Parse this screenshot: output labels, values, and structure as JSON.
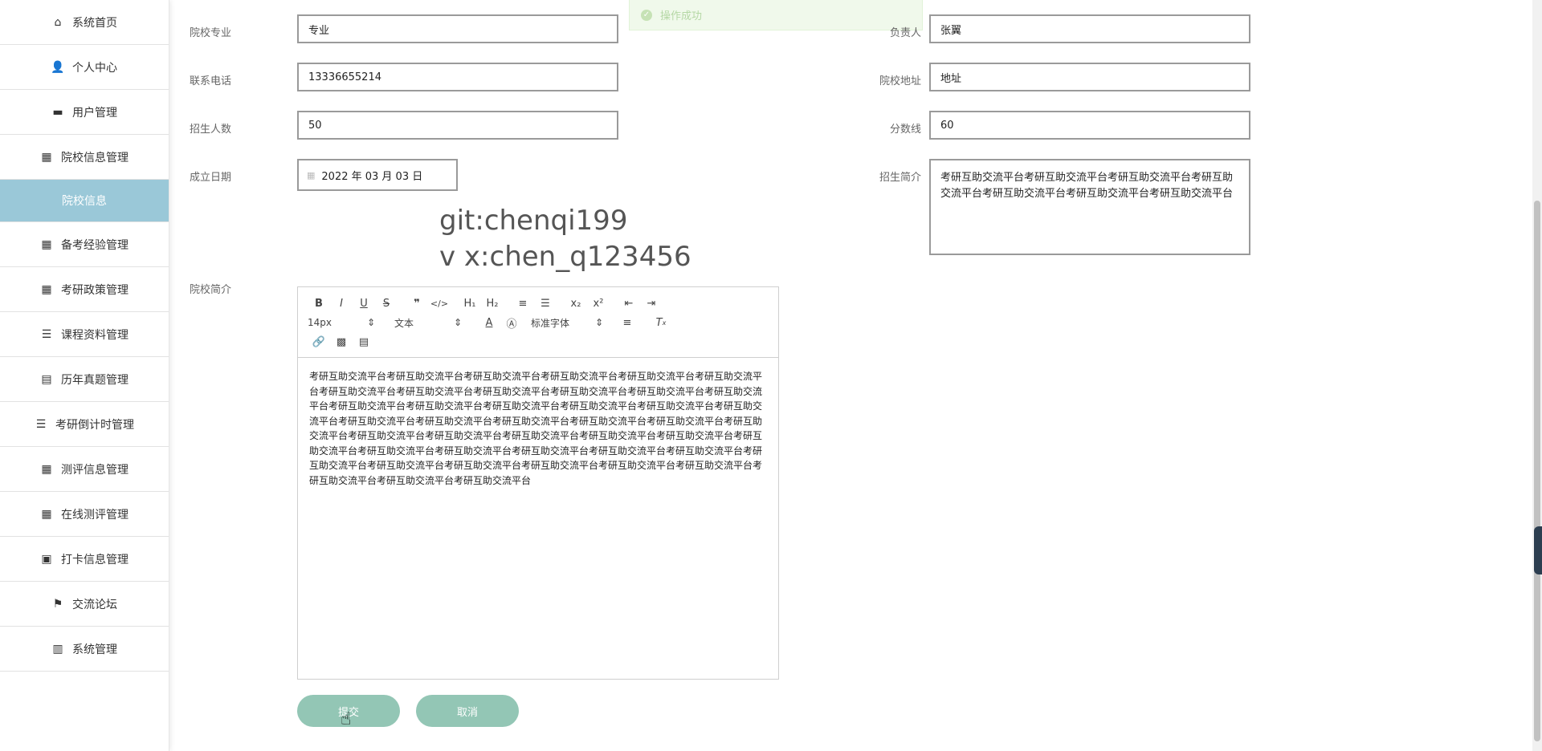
{
  "toast": {
    "message": "操作成功"
  },
  "sidebar": {
    "items": [
      {
        "label": "系统首页",
        "icon": "home-icon",
        "glyph": "⌂"
      },
      {
        "label": "个人中心",
        "icon": "user-icon",
        "glyph": "👤"
      },
      {
        "label": "用户管理",
        "icon": "monitor-icon",
        "glyph": "▬"
      },
      {
        "label": "院校信息管理",
        "icon": "grid-icon",
        "glyph": "▦"
      },
      {
        "label": "院校信息",
        "icon": "",
        "glyph": "",
        "active_sub": true
      },
      {
        "label": "备考经验管理",
        "icon": "grid-icon",
        "glyph": "▦"
      },
      {
        "label": "考研政策管理",
        "icon": "grid-icon",
        "glyph": "▦"
      },
      {
        "label": "课程资料管理",
        "icon": "list-icon",
        "glyph": "☰"
      },
      {
        "label": "历年真题管理",
        "icon": "briefcase-icon",
        "glyph": "▤"
      },
      {
        "label": "考研倒计时管理",
        "icon": "list-icon",
        "glyph": "☰"
      },
      {
        "label": "测评信息管理",
        "icon": "grid-icon",
        "glyph": "▦"
      },
      {
        "label": "在线测评管理",
        "icon": "grid-icon",
        "glyph": "▦"
      },
      {
        "label": "打卡信息管理",
        "icon": "clipboard-icon",
        "glyph": "▣"
      },
      {
        "label": "交流论坛",
        "icon": "flag-icon",
        "glyph": "⚑"
      },
      {
        "label": "系统管理",
        "icon": "book-icon",
        "glyph": "▥"
      }
    ]
  },
  "form": {
    "major_label": "院校专业",
    "major_value": "专业",
    "leader_label": "负责人",
    "leader_value": "张翼",
    "phone_label": "联系电话",
    "phone_value": "13336655214",
    "address_label": "院校地址",
    "address_value": "地址",
    "enroll_label": "招生人数",
    "enroll_value": "50",
    "score_label": "分数线",
    "score_value": "60",
    "date_label": "成立日期",
    "date_value": "2022 年 03 月 03 日",
    "brief_label": "招生简介",
    "brief_value": "考研互助交流平台考研互助交流平台考研互助交流平台考研互助交流平台考研互助交流平台考研互助交流平台考研互助交流平台",
    "intro_label": "院校简介"
  },
  "overlay": {
    "line1": "git:chenqi199",
    "line2": "v x:chen_q123456"
  },
  "editor": {
    "font_size": "14px",
    "text_type": "文本",
    "font_family": "标准字体",
    "content": "考研互助交流平台考研互助交流平台考研互助交流平台考研互助交流平台考研互助交流平台考研互助交流平台考研互助交流平台考研互助交流平台考研互助交流平台考研互助交流平台考研互助交流平台考研互助交流平台考研互助交流平台考研互助交流平台考研互助交流平台考研互助交流平台考研互助交流平台考研互助交流平台考研互助交流平台考研互助交流平台考研互助交流平台考研互助交流平台考研互助交流平台考研互助交流平台考研互助交流平台考研互助交流平台考研互助交流平台考研互助交流平台考研互助交流平台考研互助交流平台考研互助交流平台考研互助交流平台考研互助交流平台考研互助交流平台考研互助交流平台考研互助交流平台考研互助交流平台考研互助交流平台考研互助交流平台考研互助交流平台考研互助交流平台考研互助交流平台考研互助交流平台考研互助交流平台"
  },
  "buttons": {
    "submit": "提交",
    "cancel": "取消"
  },
  "colors": {
    "sidebar_active_bg": "#9ac8d8",
    "button_bg": "#93c6b5",
    "toast_bg": "#f0f9eb"
  }
}
